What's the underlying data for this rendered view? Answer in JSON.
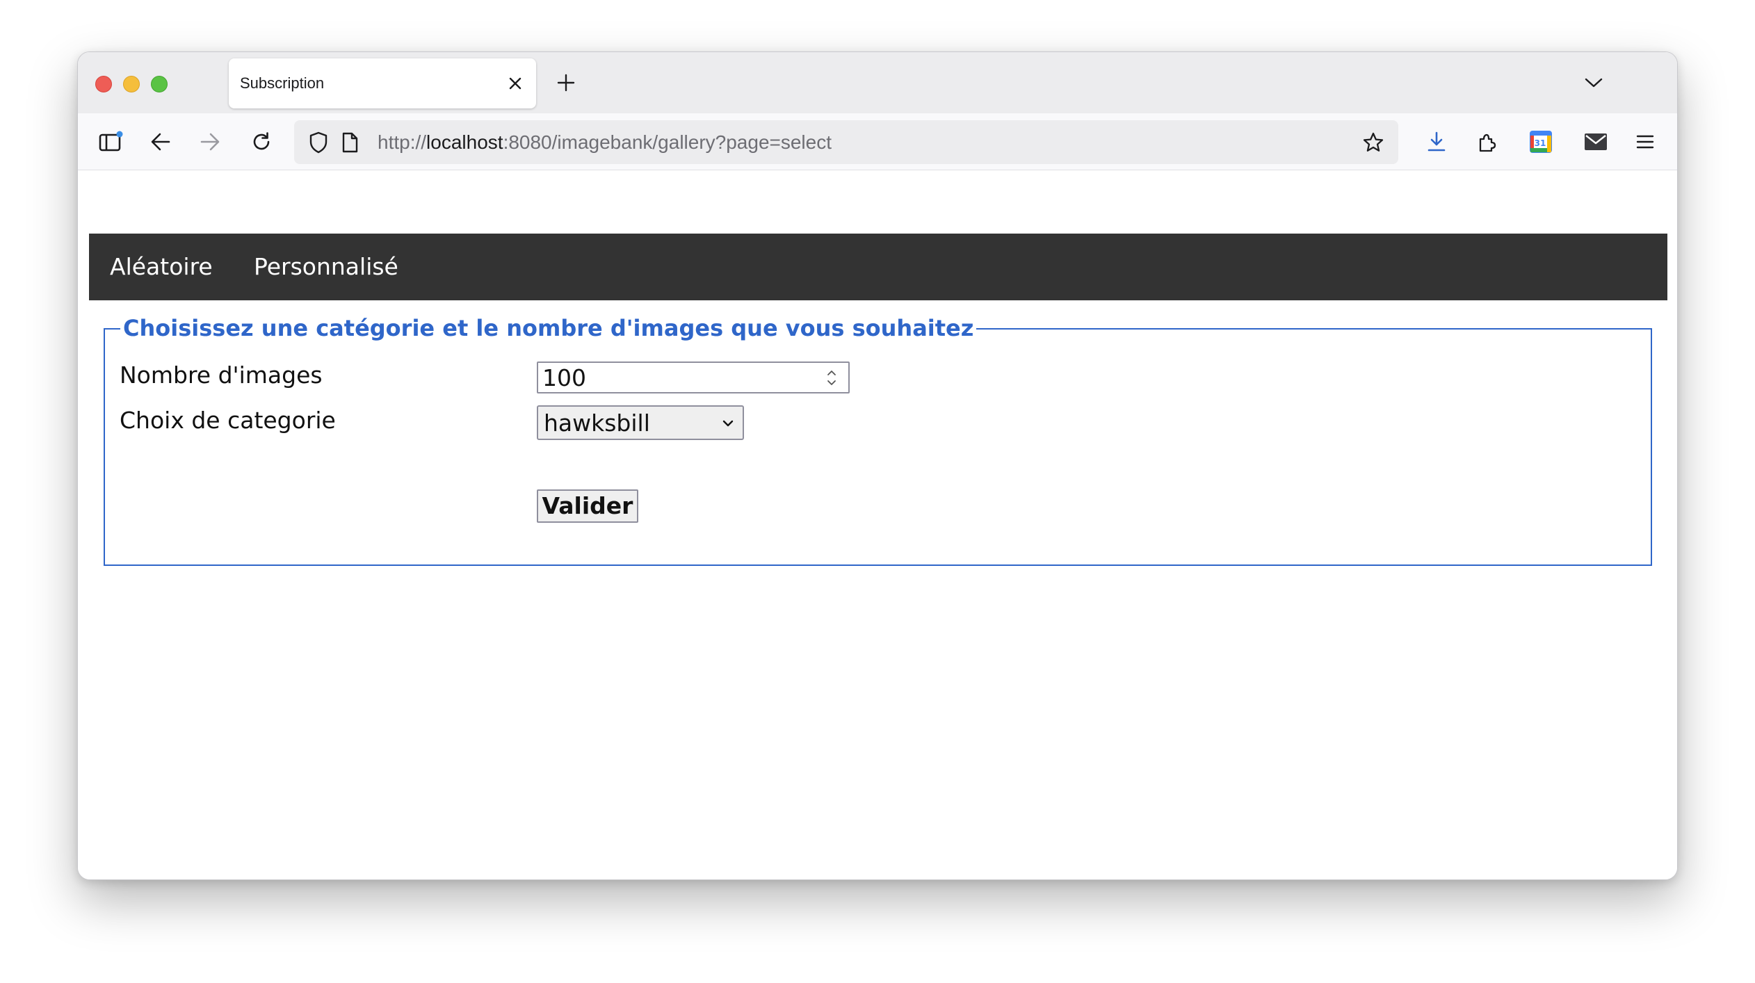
{
  "browser": {
    "tab": {
      "title": "Subscription"
    },
    "url": {
      "scheme": "http://",
      "host": "localhost",
      "rest": ":8080/imagebank/gallery?page=select"
    }
  },
  "nav": {
    "items": [
      {
        "label": "Aléatoire"
      },
      {
        "label": "Personnalisé"
      }
    ]
  },
  "form": {
    "legend": "Choisissez une catégorie et le nombre d'images que vous souhaitez",
    "count_label": "Nombre d'images",
    "count_value": "100",
    "category_label": "Choix de categorie",
    "category_value": "hawksbill",
    "submit_label": "Valider"
  },
  "colors": {
    "legend": "#2f66c9",
    "nav_bg": "#333333"
  }
}
